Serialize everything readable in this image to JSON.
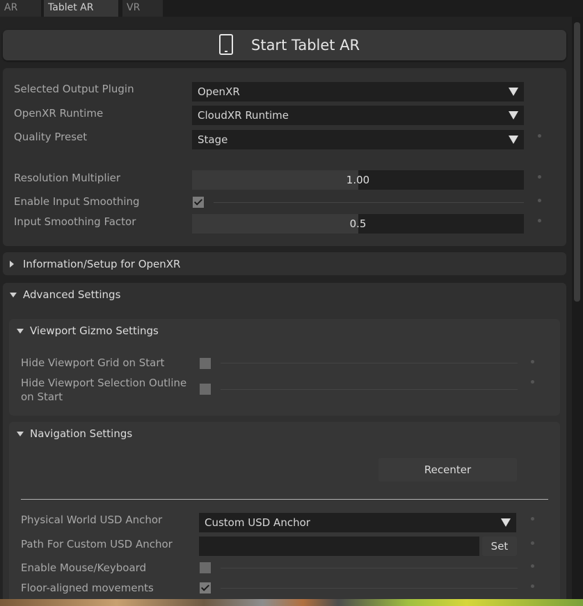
{
  "tabs": [
    {
      "label": "AR",
      "active": false
    },
    {
      "label": "Tablet AR",
      "active": true
    },
    {
      "label": "VR",
      "active": false
    }
  ],
  "start_button": {
    "label": "Start Tablet AR",
    "icon": "tablet-icon"
  },
  "output": {
    "plugin_label": "Selected Output Plugin",
    "plugin_value": "OpenXR",
    "runtime_label": "OpenXR Runtime",
    "runtime_value": "CloudXR Runtime",
    "quality_label": "Quality Preset",
    "quality_value": "Stage",
    "resolution_label": "Resolution Multiplier",
    "resolution_value": "1.00",
    "resolution_fraction": 0.5,
    "smoothing_label": "Enable Input Smoothing",
    "smoothing_checked": true,
    "smoothing_factor_label": "Input Smoothing Factor",
    "smoothing_factor_value": "0.5",
    "smoothing_factor_fraction": 0.5
  },
  "info_section": {
    "title": "Information/Setup for OpenXR",
    "expanded": false
  },
  "advanced": {
    "title": "Advanced Settings",
    "expanded": true,
    "gizmo": {
      "title": "Viewport Gizmo Settings",
      "hide_grid_label": "Hide Viewport Grid on Start",
      "hide_grid_checked": false,
      "hide_outline_label_1": "Hide Viewport Selection Outline",
      "hide_outline_label_2": "on Start",
      "hide_outline_checked": false
    },
    "navigation": {
      "title": "Navigation Settings",
      "recenter_label": "Recenter",
      "anchor_label": "Physical World USD Anchor",
      "anchor_value": "Custom USD Anchor",
      "path_label": "Path For Custom USD Anchor",
      "path_value": "",
      "set_label": "Set",
      "mouse_label": "Enable Mouse/Keyboard",
      "mouse_checked": false,
      "floor_label": "Floor-aligned movements",
      "floor_checked": true
    }
  },
  "colors": {
    "background": "#232323",
    "panel": "#303030",
    "field": "#1f1f1f",
    "accent_text": "#dcdcdc"
  }
}
